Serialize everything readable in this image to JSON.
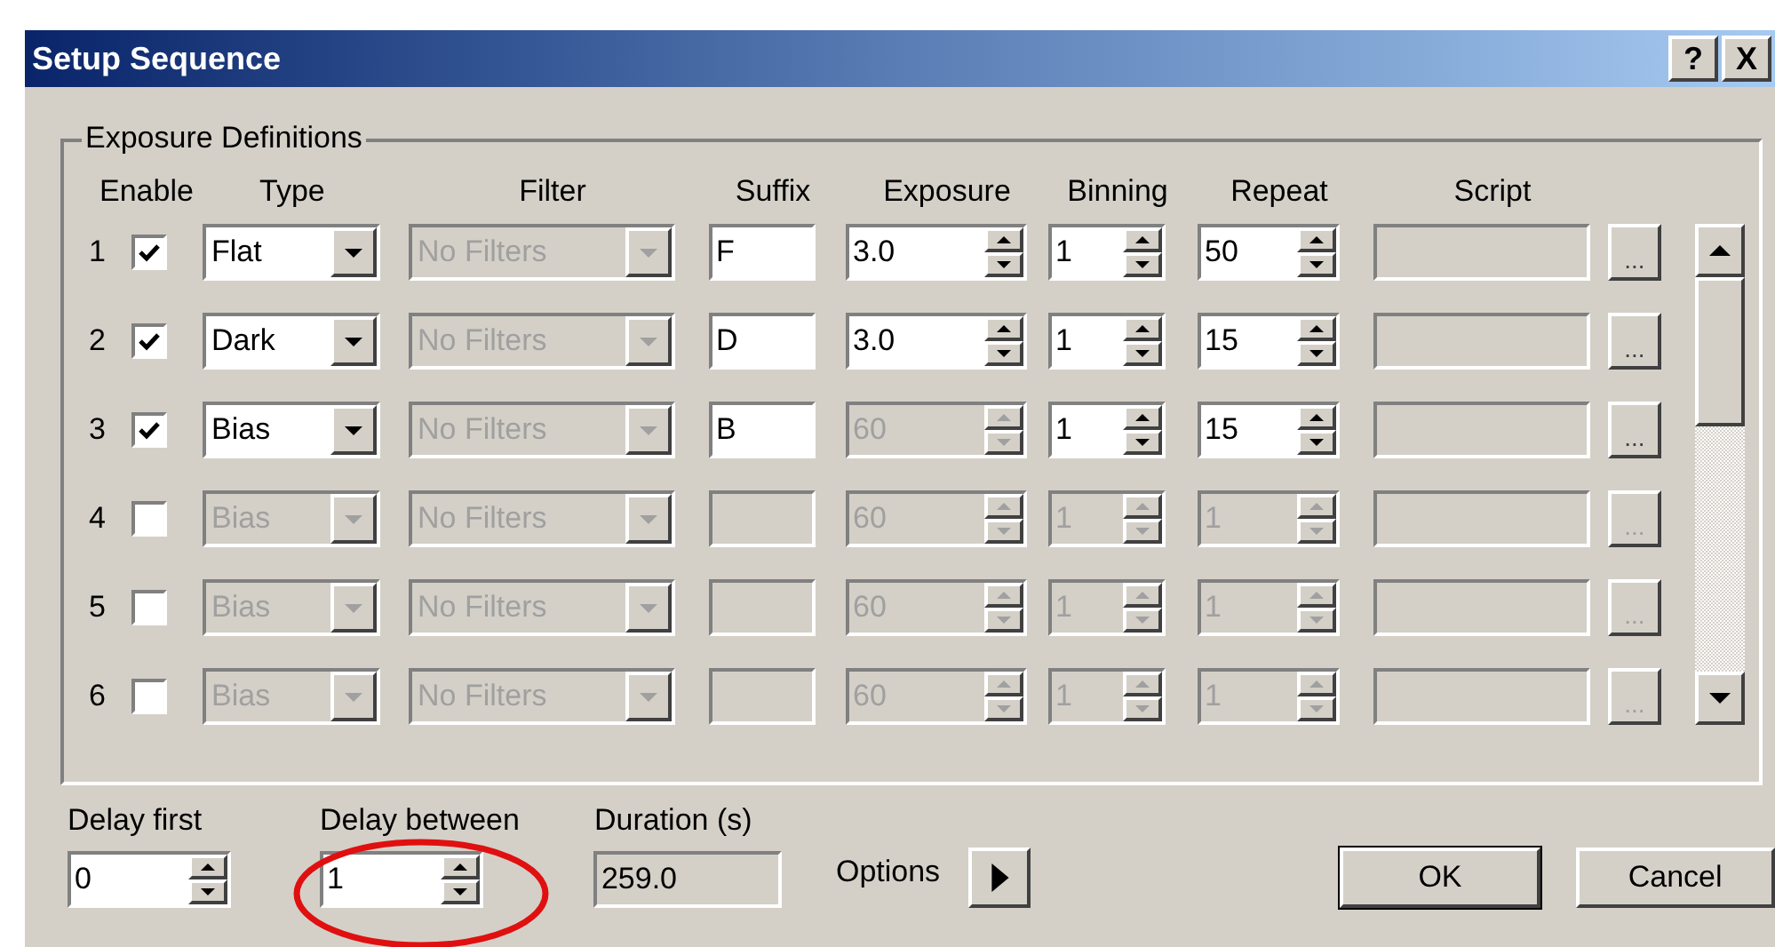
{
  "window": {
    "title": "Setup Sequence",
    "buttons": [
      "?",
      "X"
    ]
  },
  "exposure_definitions": {
    "title": "Exposure Definitions",
    "columns": [
      "Enable",
      "Type",
      "Filter",
      "Suffix",
      "Exposure",
      "Binning",
      "Repeat",
      "Script"
    ],
    "rows": [
      {
        "number": "1",
        "enabled": true,
        "type": {
          "value": "Flat",
          "disabled": false
        },
        "filter": {
          "value": "No Filters",
          "disabled": true
        },
        "suffix": {
          "value": "F",
          "disabled": false
        },
        "exposure": {
          "value": "3.0",
          "disabled": false
        },
        "binning": {
          "value": "1",
          "disabled": false
        },
        "repeat": {
          "value": "50",
          "disabled": false
        },
        "script": {
          "disabled": true
        },
        "script_button": {
          "label": "...",
          "disabled": false
        }
      },
      {
        "number": "2",
        "enabled": true,
        "type": {
          "value": "Dark",
          "disabled": false
        },
        "filter": {
          "value": "No Filters",
          "disabled": true
        },
        "suffix": {
          "value": "D",
          "disabled": false
        },
        "exposure": {
          "value": "3.0",
          "disabled": false
        },
        "binning": {
          "value": "1",
          "disabled": false
        },
        "repeat": {
          "value": "15",
          "disabled": false
        },
        "script": {
          "disabled": true
        },
        "script_button": {
          "label": "...",
          "disabled": false
        }
      },
      {
        "number": "3",
        "enabled": true,
        "type": {
          "value": "Bias",
          "disabled": false
        },
        "filter": {
          "value": "No Filters",
          "disabled": true
        },
        "suffix": {
          "value": "B",
          "disabled": false
        },
        "exposure": {
          "value": "60",
          "disabled": true
        },
        "binning": {
          "value": "1",
          "disabled": false
        },
        "repeat": {
          "value": "15",
          "disabled": false
        },
        "script": {
          "disabled": true
        },
        "script_button": {
          "label": "...",
          "disabled": false
        }
      },
      {
        "number": "4",
        "enabled": false,
        "type": {
          "value": "Bias",
          "disabled": true
        },
        "filter": {
          "value": "No Filters",
          "disabled": true
        },
        "suffix": {
          "disabled": true
        },
        "exposure": {
          "value": "60",
          "disabled": true
        },
        "binning": {
          "value": "1",
          "disabled": true
        },
        "repeat": {
          "value": "1",
          "disabled": true
        },
        "script": {
          "disabled": true
        },
        "script_button": {
          "label": "...",
          "disabled": true
        }
      },
      {
        "number": "5",
        "enabled": false,
        "type": {
          "value": "Bias",
          "disabled": true
        },
        "filter": {
          "value": "No Filters",
          "disabled": true
        },
        "suffix": {
          "disabled": true
        },
        "exposure": {
          "value": "60",
          "disabled": true
        },
        "binning": {
          "value": "1",
          "disabled": true
        },
        "repeat": {
          "value": "1",
          "disabled": true
        },
        "script": {
          "disabled": true
        },
        "script_button": {
          "label": "...",
          "disabled": true
        }
      },
      {
        "number": "6",
        "enabled": false,
        "type": {
          "value": "Bias",
          "disabled": true
        },
        "filter": {
          "value": "No Filters",
          "disabled": true
        },
        "suffix": {
          "disabled": true
        },
        "exposure": {
          "value": "60",
          "disabled": true
        },
        "binning": {
          "value": "1",
          "disabled": true
        },
        "repeat": {
          "value": "1",
          "disabled": true
        },
        "script": {
          "disabled": true
        },
        "script_button": {
          "label": "...",
          "disabled": true
        }
      }
    ]
  },
  "delay_first": {
    "label": "Delay first",
    "value": "0"
  },
  "delay_between": {
    "label": "Delay between",
    "value": "1"
  },
  "duration": {
    "label": "Duration (s)",
    "value": "259.0"
  },
  "options": {
    "label": "Options"
  },
  "buttons": [
    "OK",
    "Cancel"
  ]
}
